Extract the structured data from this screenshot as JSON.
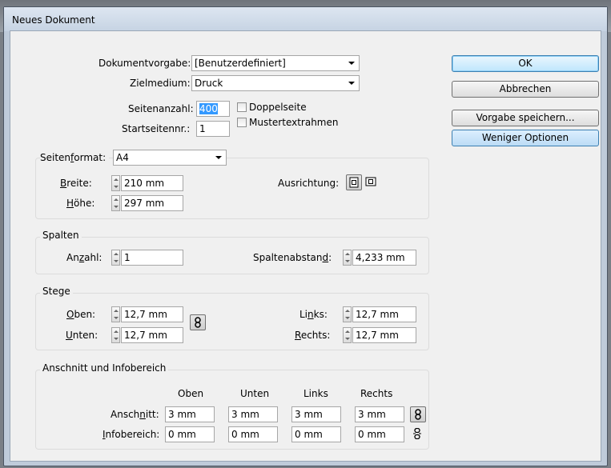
{
  "window": {
    "title": "Neues Dokument"
  },
  "top": {
    "preset_label": "Dokumentvorgabe:",
    "preset_value": "[Benutzerdefiniert]",
    "intent_label": "Zielmedium:",
    "intent_value": "Druck",
    "pages_label": "Seitenanzahl:",
    "pages_value": "400",
    "start_label": "Startseitennr.:",
    "start_value": "1",
    "facing_label": "Doppelseite",
    "master_label": "Mustertextrahmen"
  },
  "buttons": {
    "ok": "OK",
    "cancel": "Abbrechen",
    "save_preset": "Vorgabe speichern...",
    "fewer_options": "Weniger Optionen"
  },
  "page_size": {
    "label": "Seitenformat:",
    "value": "A4",
    "width_label": "Breite:",
    "width_value": "210 mm",
    "height_label": "Höhe:",
    "height_value": "297 mm",
    "orientation_label": "Ausrichtung:"
  },
  "columns": {
    "title": "Spalten",
    "count_label": "Anzahl:",
    "count_value": "1",
    "gutter_label": "Spaltenabstand:",
    "gutter_value": "4,233 mm"
  },
  "margins": {
    "title": "Stege",
    "top_label": "Oben:",
    "top_value": "12,7 mm",
    "bottom_label": "Unten:",
    "bottom_value": "12,7 mm",
    "left_label": "Links:",
    "left_value": "12,7 mm",
    "right_label": "Rechts:",
    "right_value": "12,7 mm"
  },
  "bleed": {
    "title": "Anschnitt und Infobereich",
    "headers": [
      "Oben",
      "Unten",
      "Links",
      "Rechts"
    ],
    "bleed_label": "Anschnitt:",
    "bleed_values": [
      "3 mm",
      "3 mm",
      "3 mm",
      "3 mm"
    ],
    "slug_label": "Infobereich:",
    "slug_values": [
      "0 mm",
      "0 mm",
      "0 mm",
      "0 mm"
    ]
  }
}
